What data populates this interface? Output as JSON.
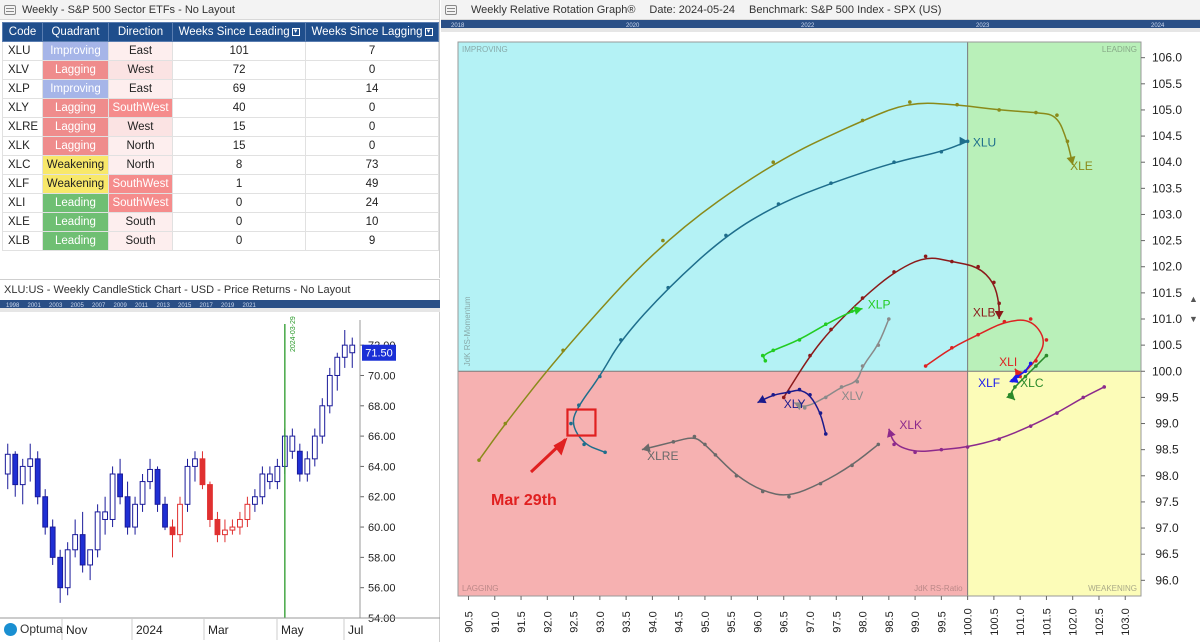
{
  "table_panel": {
    "title": "Weekly - S&P 500 Sector ETFs - No Layout",
    "headers": [
      "Code",
      "Quadrant",
      "Direction",
      "Weeks Since Leading",
      "Weeks Since Lagging"
    ],
    "rows": [
      {
        "code": "XLU",
        "quadrant": "Improving",
        "direction": "East",
        "lead": "101",
        "lag": "7"
      },
      {
        "code": "XLV",
        "quadrant": "Lagging",
        "direction": "West",
        "lead": "72",
        "lag": "0"
      },
      {
        "code": "XLP",
        "quadrant": "Improving",
        "direction": "East",
        "lead": "69",
        "lag": "14"
      },
      {
        "code": "XLY",
        "quadrant": "Lagging",
        "direction": "SouthWest",
        "lead": "40",
        "lag": "0"
      },
      {
        "code": "XLRE",
        "quadrant": "Lagging",
        "direction": "West",
        "lead": "15",
        "lag": "0"
      },
      {
        "code": "XLK",
        "quadrant": "Lagging",
        "direction": "North",
        "lead": "15",
        "lag": "0"
      },
      {
        "code": "XLC",
        "quadrant": "Weakening",
        "direction": "North",
        "lead": "8",
        "lag": "73"
      },
      {
        "code": "XLF",
        "quadrant": "Weakening",
        "direction": "SouthWest",
        "lead": "1",
        "lag": "49"
      },
      {
        "code": "XLI",
        "quadrant": "Leading",
        "direction": "SouthWest",
        "lead": "0",
        "lag": "24"
      },
      {
        "code": "XLE",
        "quadrant": "Leading",
        "direction": "South",
        "lead": "0",
        "lag": "10"
      },
      {
        "code": "XLB",
        "quadrant": "Leading",
        "direction": "South",
        "lead": "0",
        "lag": "9"
      }
    ]
  },
  "colors": {
    "improving": "#b4f2f5",
    "leading": "#b9f0b9",
    "lagging": "#f6b1b1",
    "weakening": "#fcfcb8",
    "header": "#1f4e8c",
    "up_candle": "#ffffff",
    "down_candle": "#1f2fd4",
    "red_candle": "#e03030",
    "marker_line": "#2a9a2a",
    "price_tag": "#1a2fd6"
  },
  "rrg_panel": {
    "title": "Weekly Relative Rotation Graph®",
    "date": "Date: 2024-05-24",
    "benchmark": "Benchmark: S&P 500 Index - SPX (US)",
    "timeline_labels": [
      "2018",
      "2020",
      "2022",
      "2023",
      "2024"
    ],
    "quadrant_labels": {
      "improving": "IMPROVING",
      "leading": "LEADING",
      "lagging": "LAGGING",
      "weakening": "WEAKENING"
    },
    "x_axis_title": "JdK RS-Ratio",
    "y_axis_title": "JdK RS-Momentum",
    "annotation": "Mar 29th"
  },
  "candle_panel": {
    "title": "XLU:US - Weekly CandleStick Chart - USD - Price Returns - No Layout",
    "timeline_labels": [
      "1998",
      "2001",
      "2003",
      "2005",
      "2007",
      "2009",
      "2011",
      "2013",
      "2015",
      "2017",
      "2019",
      "2021"
    ],
    "marker_label": "2024-03-29",
    "last_price": "71.50",
    "yticks": [
      "72.00",
      "70.00",
      "68.00",
      "66.00",
      "64.00",
      "62.00",
      "60.00",
      "58.00",
      "56.00",
      "54.00"
    ],
    "xlabels": [
      "Nov",
      "2024",
      "Mar",
      "May",
      "Jul"
    ],
    "brand": "Optuma"
  },
  "chart_data": [
    {
      "type": "scatter",
      "title": "Weekly Relative Rotation Graph®",
      "xlabel": "JdK RS-Ratio",
      "ylabel": "JdK RS-Momentum",
      "xlim": [
        90.3,
        103.3
      ],
      "ylim": [
        95.7,
        106.3
      ],
      "xticks": [
        90.5,
        91.0,
        91.5,
        92.0,
        92.5,
        93.0,
        93.5,
        94.0,
        94.5,
        95.0,
        95.5,
        96.0,
        96.5,
        97.0,
        97.5,
        98.0,
        98.5,
        99.0,
        99.5,
        100.0,
        100.5,
        101.0,
        101.5,
        102.0,
        102.5,
        103.0
      ],
      "yticks": [
        96.0,
        96.5,
        97.0,
        97.5,
        98.0,
        98.5,
        99.0,
        99.5,
        100.0,
        100.5,
        101.0,
        101.5,
        102.0,
        102.5,
        103.0,
        103.5,
        104.0,
        104.5,
        105.0,
        105.5,
        106.0
      ],
      "series": [
        {
          "name": "XLE",
          "color": "#8a8a1a",
          "x": [
            90.7,
            91.2,
            92.3,
            94.2,
            96.3,
            98.0,
            98.9,
            99.8,
            100.6,
            101.3,
            101.7,
            101.9,
            102.0
          ],
          "y": [
            98.3,
            99.0,
            100.4,
            102.5,
            104.0,
            104.8,
            105.15,
            105.1,
            105.0,
            104.95,
            104.9,
            104.4,
            103.95
          ]
        },
        {
          "name": "XLU",
          "color": "#1e6e8c",
          "x": [
            93.1,
            92.7,
            92.45,
            92.6,
            93.0,
            93.4,
            94.3,
            95.4,
            96.4,
            97.4,
            98.6,
            99.5,
            100.0,
            100.0
          ],
          "y": [
            98.45,
            98.6,
            99.0,
            99.35,
            99.9,
            100.6,
            101.6,
            102.6,
            103.2,
            103.6,
            104.0,
            104.2,
            104.4,
            104.4
          ]
        },
        {
          "name": "XLB",
          "color": "#8b1a1a",
          "x": [
            96.5,
            97.0,
            97.4,
            98.0,
            98.6,
            99.2,
            99.7,
            100.2,
            100.5,
            100.6,
            100.6
          ],
          "y": [
            99.5,
            100.3,
            100.8,
            101.4,
            101.9,
            102.2,
            102.1,
            102.0,
            101.7,
            101.3,
            101.0
          ]
        },
        {
          "name": "XLP",
          "color": "#22cc22",
          "x": [
            96.15,
            96.1,
            96.3,
            96.8,
            97.3,
            97.8,
            98.0
          ],
          "y": [
            100.2,
            100.3,
            100.4,
            100.6,
            100.9,
            101.15,
            101.2
          ]
        },
        {
          "name": "XLV",
          "color": "#8a8a8a",
          "x": [
            98.5,
            98.3,
            98.0,
            97.9,
            97.6,
            97.3,
            96.9,
            96.7
          ],
          "y": [
            101.0,
            100.5,
            100.1,
            99.8,
            99.7,
            99.5,
            99.3,
            99.4
          ]
        },
        {
          "name": "XLY",
          "color": "#1a1a8c",
          "x": [
            97.3,
            97.2,
            97.0,
            96.8,
            96.6,
            96.3,
            96.0
          ],
          "y": [
            98.8,
            99.2,
            99.55,
            99.65,
            99.6,
            99.55,
            99.4
          ]
        },
        {
          "name": "XLRE",
          "color": "#6a6a6a",
          "x": [
            98.3,
            97.8,
            97.2,
            96.6,
            96.1,
            95.6,
            95.2,
            95.0,
            94.8,
            94.4,
            93.8
          ],
          "y": [
            98.6,
            98.2,
            97.85,
            97.6,
            97.7,
            98.0,
            98.4,
            98.6,
            98.75,
            98.65,
            98.5
          ]
        },
        {
          "name": "XLK",
          "color": "#8c2a8c",
          "x": [
            102.6,
            102.2,
            101.7,
            101.2,
            100.6,
            100.0,
            99.5,
            99.0,
            98.6,
            98.5
          ],
          "y": [
            99.7,
            99.5,
            99.2,
            98.95,
            98.7,
            98.55,
            98.5,
            98.45,
            98.6,
            98.9
          ]
        },
        {
          "name": "XLI",
          "color": "#dd2222",
          "x": [
            99.2,
            99.7,
            100.2,
            100.7,
            101.2,
            101.5,
            101.3,
            101.0,
            100.9
          ],
          "y": [
            100.1,
            100.45,
            100.7,
            100.95,
            101.0,
            100.6,
            100.2,
            99.9,
            100.05
          ]
        },
        {
          "name": "XLF",
          "color": "#1a1aee",
          "x": [
            101.2,
            101.1,
            100.95,
            100.85,
            100.8
          ],
          "y": [
            100.15,
            100.0,
            99.9,
            99.82,
            99.8
          ]
        },
        {
          "name": "XLC",
          "color": "#2a8a2a",
          "x": [
            101.5,
            101.3,
            101.1,
            100.9,
            100.8,
            100.9
          ],
          "y": [
            100.3,
            100.1,
            99.9,
            99.7,
            99.55,
            99.45
          ]
        }
      ],
      "labels": [
        {
          "text": "XLE",
          "x": 101.95,
          "y": 103.85
        },
        {
          "text": "XLU",
          "x": 100.1,
          "y": 104.3
        },
        {
          "text": "XLB",
          "x": 100.1,
          "y": 101.05
        },
        {
          "text": "XLP",
          "x": 98.1,
          "y": 101.2
        },
        {
          "text": "XLV",
          "x": 97.6,
          "y": 99.45
        },
        {
          "text": "XLY",
          "x": 96.5,
          "y": 99.3
        },
        {
          "text": "XLRE",
          "x": 93.9,
          "y": 98.3
        },
        {
          "text": "XLK",
          "x": 98.7,
          "y": 98.9
        },
        {
          "text": "XLI",
          "x": 100.6,
          "y": 100.1
        },
        {
          "text": "XLF",
          "x": 100.2,
          "y": 99.7
        },
        {
          "text": "XLC",
          "x": 101.0,
          "y": 99.7
        }
      ],
      "highlight": {
        "x": 92.65,
        "y": 99.0
      },
      "quadrant_split": {
        "x": 100.0,
        "y": 100.0
      }
    },
    {
      "type": "candlestick",
      "title": "XLU:US - Weekly CandleStick Chart - USD - Price Returns - No Layout",
      "ylim": [
        54.0,
        73.0
      ],
      "candles": [
        [
          63.5,
          65.5,
          62.5,
          64.8
        ],
        [
          64.8,
          65.0,
          62.0,
          62.8
        ],
        [
          62.8,
          64.5,
          61.5,
          64.0
        ],
        [
          64.0,
          65.5,
          63.0,
          64.5
        ],
        [
          64.5,
          65.0,
          61.5,
          62.0
        ],
        [
          62.0,
          62.5,
          59.5,
          60.0
        ],
        [
          60.0,
          60.5,
          57.5,
          58.0
        ],
        [
          58.0,
          58.5,
          55.0,
          56.0
        ],
        [
          56.0,
          59.0,
          55.5,
          58.5
        ],
        [
          58.5,
          60.5,
          58.0,
          59.5
        ],
        [
          59.5,
          61.0,
          57.0,
          57.5
        ],
        [
          57.5,
          58.5,
          56.5,
          58.5
        ],
        [
          58.5,
          61.5,
          58.0,
          61.0
        ],
        [
          61.0,
          62.0,
          59.5,
          60.5
        ],
        [
          60.5,
          64.0,
          60.0,
          63.5
        ],
        [
          63.5,
          64.5,
          61.5,
          62.0
        ],
        [
          62.0,
          63.0,
          59.5,
          60.0
        ],
        [
          60.0,
          62.0,
          59.5,
          61.5
        ],
        [
          61.5,
          63.5,
          61.0,
          63.0
        ],
        [
          63.0,
          64.5,
          62.5,
          63.8
        ],
        [
          63.8,
          64.0,
          61.0,
          61.5
        ],
        [
          61.5,
          62.0,
          59.8,
          60.0
        ],
        [
          60.0,
          60.5,
          58.0,
          59.5
        ],
        [
          59.5,
          62.0,
          59.0,
          61.5
        ],
        [
          61.5,
          64.5,
          61.0,
          64.0
        ],
        [
          64.0,
          65.0,
          63.0,
          64.5
        ],
        [
          64.5,
          65.0,
          62.5,
          62.8
        ],
        [
          62.8,
          63.0,
          60.0,
          60.5
        ],
        [
          60.5,
          61.0,
          59.0,
          59.5
        ],
        [
          59.5,
          60.5,
          59.0,
          59.8
        ],
        [
          59.8,
          60.5,
          59.5,
          60.0
        ],
        [
          60.0,
          61.0,
          59.5,
          60.5
        ],
        [
          60.5,
          62.0,
          60.0,
          61.5
        ],
        [
          61.5,
          62.5,
          61.0,
          62.0
        ],
        [
          62.0,
          64.0,
          61.5,
          63.5
        ],
        [
          63.5,
          64.0,
          62.5,
          63.0
        ],
        [
          63.0,
          64.5,
          62.5,
          64.0
        ],
        [
          64.0,
          66.5,
          63.5,
          66.0
        ],
        [
          66.0,
          66.5,
          64.5,
          65.0
        ],
        [
          65.0,
          65.5,
          63.0,
          63.5
        ],
        [
          63.5,
          65.0,
          63.0,
          64.5
        ],
        [
          64.5,
          66.5,
          64.0,
          66.0
        ],
        [
          66.0,
          68.5,
          65.5,
          68.0
        ],
        [
          68.0,
          70.5,
          67.5,
          70.0
        ],
        [
          70.0,
          71.5,
          69.0,
          71.2
        ],
        [
          71.2,
          73.0,
          70.5,
          72.0
        ],
        [
          72.0,
          72.5,
          70.5,
          71.5
        ]
      ],
      "down_indices": [
        1,
        4,
        5,
        6,
        7,
        10,
        15,
        16,
        20,
        21,
        22,
        26,
        27,
        28,
        39
      ],
      "red_indices": [
        22,
        23,
        26,
        27,
        28,
        29,
        30,
        31,
        32
      ]
    }
  ]
}
